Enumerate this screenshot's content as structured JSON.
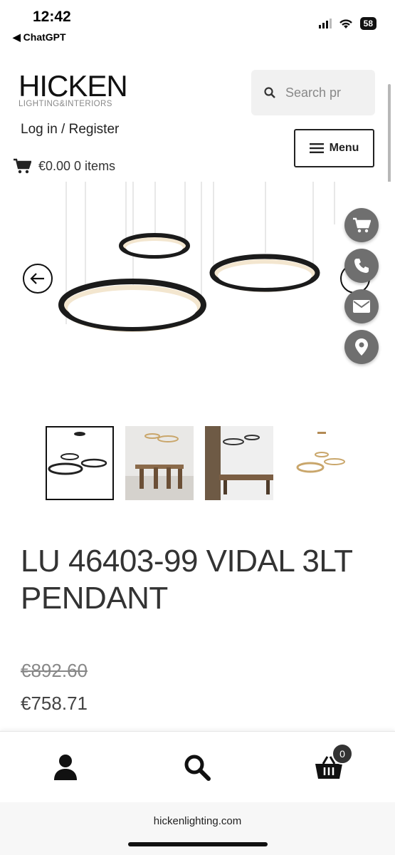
{
  "status_bar": {
    "time": "12:42",
    "back_app": "◀ ChatGPT",
    "battery": "58"
  },
  "header": {
    "logo_main": "HICKEN",
    "logo_sub": "LIGHTING&INTERIORS",
    "search_placeholder": "Search pr",
    "login_label": "Log in / Register",
    "menu_label": "Menu",
    "cart_summary": "€0.00 0 items"
  },
  "product": {
    "title": "LU 46403-99 VIDAL 3LT PENDANT",
    "price_old": "€892.60",
    "price_new": "€758.71"
  },
  "gallery": {
    "thumbnail_count": 4,
    "active_index": 0
  },
  "float_actions": [
    "cart-icon",
    "phone-icon",
    "mail-icon",
    "location-pin-icon"
  ],
  "bottom_nav": {
    "cart_count": "0",
    "items": [
      "account-icon",
      "search-icon",
      "basket-icon"
    ]
  },
  "browser": {
    "url": "hickenlighting.com"
  },
  "colors": {
    "float_button": "#6f6f6f",
    "ring_dark": "#1b1b1b",
    "ring_glow": "#f3e6cf"
  }
}
